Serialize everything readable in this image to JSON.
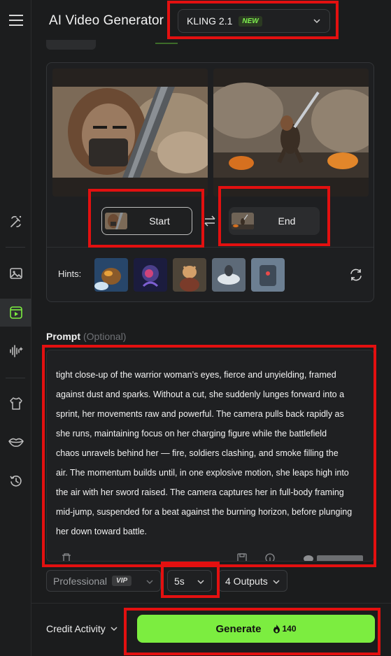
{
  "header": {
    "title": "AI Video Generator",
    "model": {
      "name": "KLING 2.1",
      "badge": "NEW"
    }
  },
  "sidebar": {
    "items": [
      {
        "icon": "menu-icon"
      },
      {
        "icon": "magic-edit-icon"
      },
      {
        "icon": "image-icon"
      },
      {
        "icon": "video-icon",
        "active": true
      },
      {
        "icon": "audio-wave-icon"
      },
      {
        "icon": "shirt-icon"
      },
      {
        "icon": "lips-icon"
      },
      {
        "icon": "history-icon"
      }
    ]
  },
  "frames": {
    "start_label": "Start",
    "end_label": "End"
  },
  "hints": {
    "label": "Hints:",
    "items": [
      "hint-thumbnail-1",
      "hint-thumbnail-2",
      "hint-thumbnail-3",
      "hint-thumbnail-4",
      "hint-thumbnail-5"
    ]
  },
  "prompt": {
    "label": "Prompt",
    "optional": "(Optional)",
    "lines": [
      "tight close-up of the warrior woman’s eyes, fierce and unyielding, framed",
      "against dust and sparks. Without a cut, she suddenly lunges forward into a",
      "sprint, her movements raw and powerful. The camera pulls back rapidly as",
      "she runs, maintaining focus on her charging figure while the battlefield",
      "chaos unravels behind her — fire, soldiers clashing, and smoke filling the",
      "air. The momentum builds until, in one explosive motion, she leaps high into",
      "the air with her sword raised. The camera captures her in full-body framing",
      "mid-jump, suspended for a beat against the burning horizon, before plunging",
      "her down toward battle."
    ]
  },
  "options": {
    "quality": "Professional",
    "quality_badge": "VIP",
    "duration": "5s",
    "outputs": "4 Outputs"
  },
  "footer": {
    "credit_label": "Credit Activity",
    "generate_label": "Generate",
    "credit_cost": "140"
  },
  "colors": {
    "accent": "#7ced40",
    "highlight": "#e31010",
    "background": "#1b1c1d"
  }
}
